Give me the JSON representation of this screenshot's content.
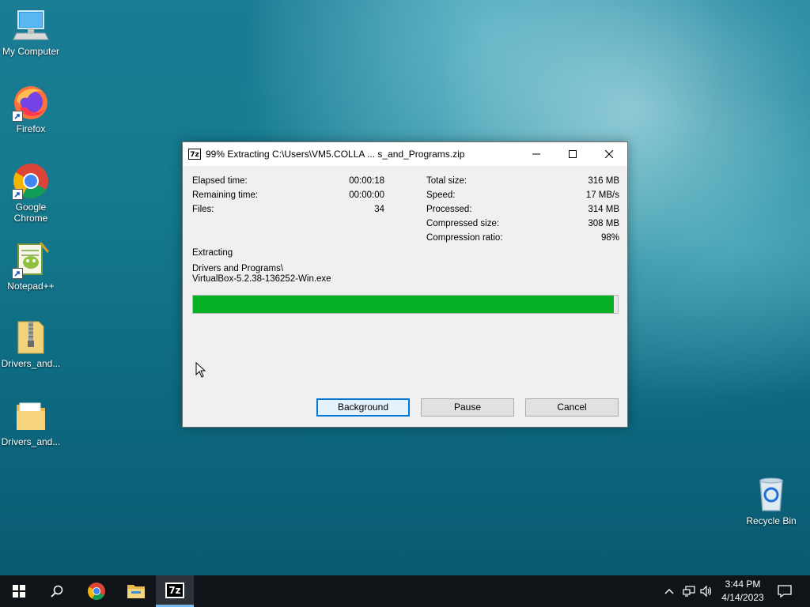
{
  "desktop": {
    "icons": [
      {
        "label": "My Computer",
        "icon": "monitor-icon"
      },
      {
        "label": "Firefox",
        "icon": "firefox-icon"
      },
      {
        "label": "Google Chrome",
        "icon": "chrome-icon"
      },
      {
        "label": "Notepad++",
        "icon": "notepadpp-icon"
      },
      {
        "label": "Drivers_and...",
        "icon": "zip-folder-icon"
      },
      {
        "label": "Drivers_and...",
        "icon": "folder-icon"
      },
      {
        "label": "Recycle Bin",
        "icon": "recycle-bin-icon"
      }
    ]
  },
  "dialog": {
    "app_icon_text": "7z",
    "title": "99% Extracting C:\\Users\\VM5.COLLA ... s_and_Programs.zip",
    "left_stats": [
      {
        "label": "Elapsed time:",
        "value": "00:00:18"
      },
      {
        "label": "Remaining time:",
        "value": "00:00:00"
      },
      {
        "label": "Files:",
        "value": "34"
      }
    ],
    "right_stats": [
      {
        "label": "Total size:",
        "value": "316 MB"
      },
      {
        "label": "Speed:",
        "value": "17 MB/s"
      },
      {
        "label": "Processed:",
        "value": "314 MB"
      },
      {
        "label": "Compressed size:",
        "value": "308 MB"
      },
      {
        "label": "Compression ratio:",
        "value": "98%"
      }
    ],
    "status_label": "Extracting",
    "current_path_line1": "Drivers and Programs\\",
    "current_path_line2": "VirtualBox-5.2.38-136252-Win.exe",
    "progress_fraction": 0.99,
    "progress_color": "#06b025",
    "buttons": {
      "background": "Background",
      "pause": "Pause",
      "cancel": "Cancel"
    }
  },
  "taskbar": {
    "time": "3:44 PM",
    "date": "4/14/2023",
    "active_app_label": "7z"
  }
}
